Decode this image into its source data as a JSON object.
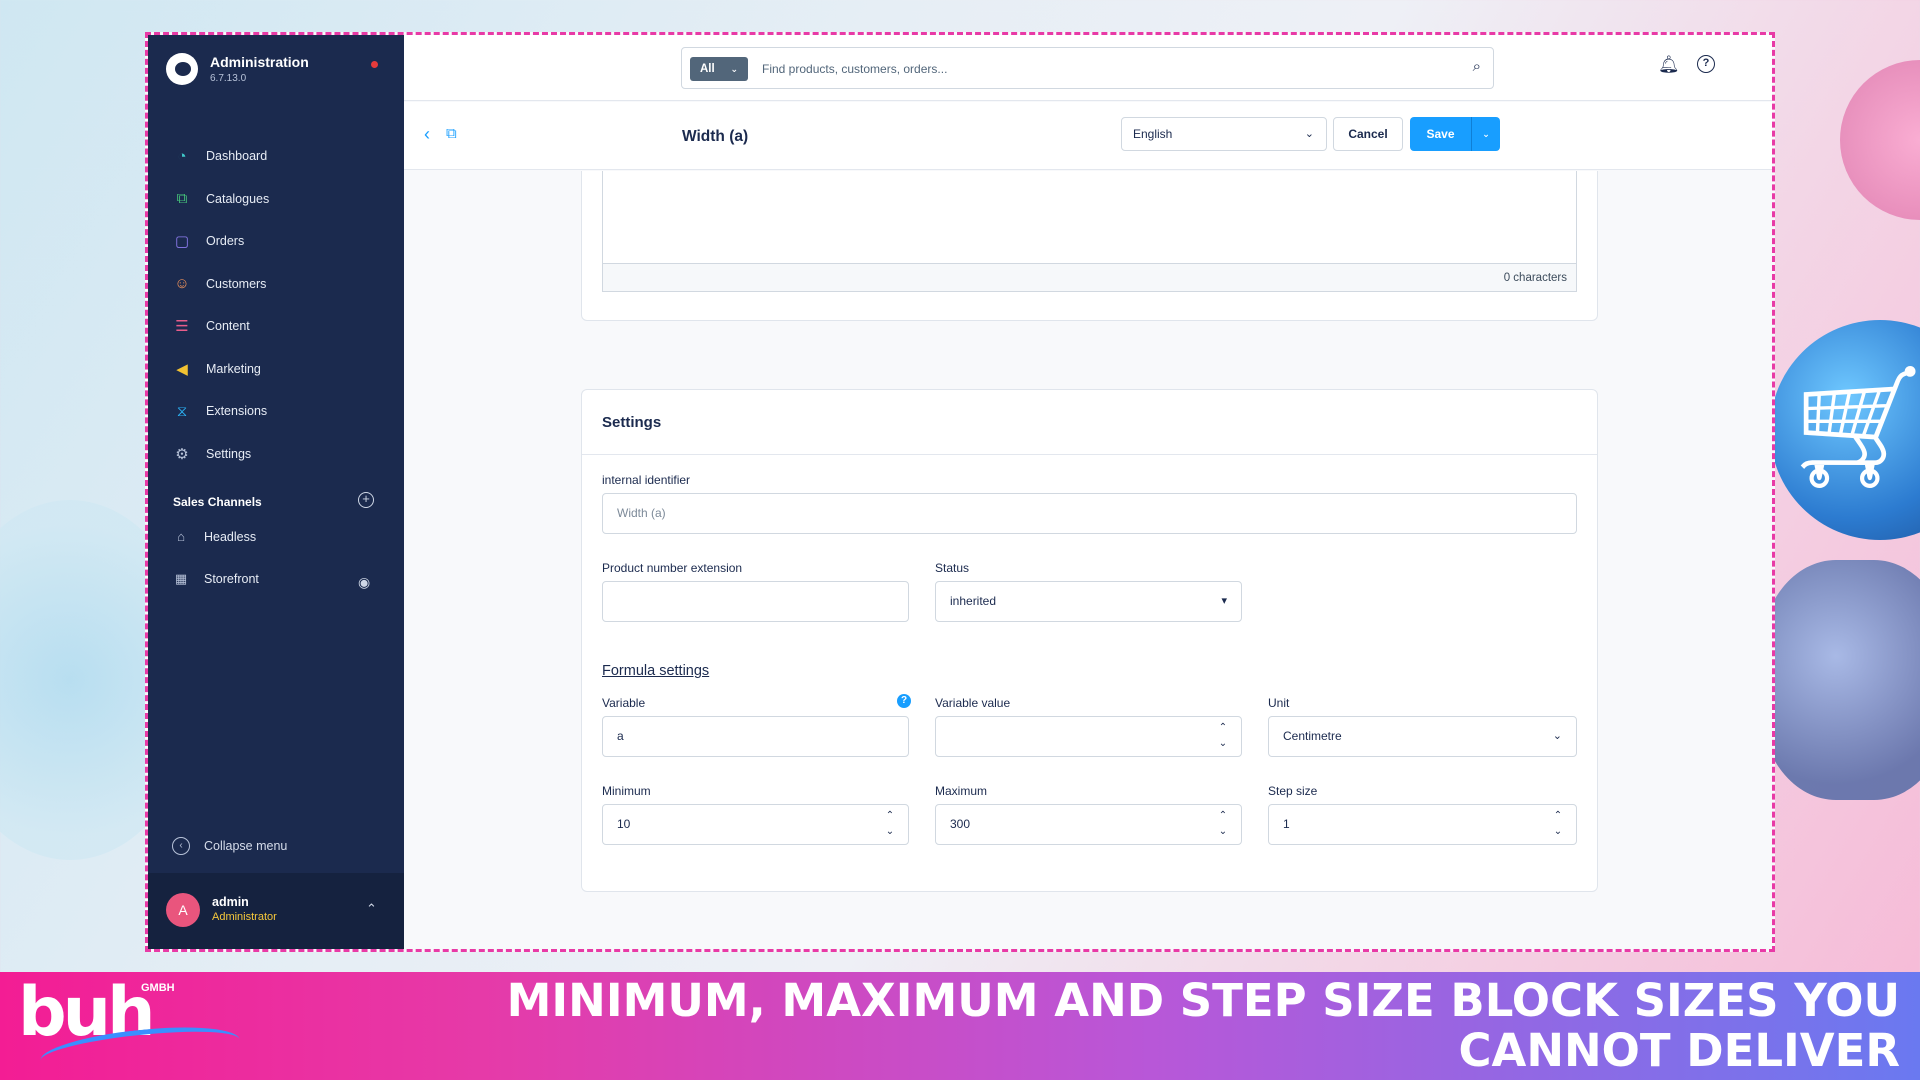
{
  "sidebar": {
    "brand_title": "Administration",
    "brand_version": "6.7.13.0",
    "items": [
      {
        "label": "Dashboard",
        "icon": "dashboard-icon",
        "color": "#3fc7c7"
      },
      {
        "label": "Catalogues",
        "icon": "catalogues-icon",
        "color": "#45c27a"
      },
      {
        "label": "Orders",
        "icon": "orders-icon",
        "color": "#8e7cf0"
      },
      {
        "label": "Customers",
        "icon": "customers-icon",
        "color": "#f0925a"
      },
      {
        "label": "Content",
        "icon": "content-icon",
        "color": "#e95d8b"
      },
      {
        "label": "Marketing",
        "icon": "marketing-icon",
        "color": "#f2c232"
      },
      {
        "label": "Extensions",
        "icon": "extensions-icon",
        "color": "#2bb0f2"
      },
      {
        "label": "Settings",
        "icon": "settings-icon",
        "color": "#b7c2d8"
      }
    ],
    "sales_channels_title": "Sales Channels",
    "channels": [
      {
        "label": "Headless",
        "icon": "basket-icon"
      },
      {
        "label": "Storefront",
        "icon": "storefront-icon"
      }
    ],
    "collapse_label": "Collapse menu",
    "user": {
      "initial": "A",
      "name": "admin",
      "role": "Administrator"
    }
  },
  "topbar": {
    "search_scope": "All",
    "search_placeholder": "Find products, customers, orders..."
  },
  "toolbar": {
    "title": "Width (a)",
    "language": "English",
    "cancel_label": "Cancel",
    "save_label": "Save"
  },
  "description": {
    "char_count": "0 characters"
  },
  "settings": {
    "title": "Settings",
    "internal_identifier_label": "internal identifier",
    "internal_identifier_placeholder": "Width (a)",
    "product_number_label": "Product number extension",
    "product_number_value": "",
    "status_label": "Status",
    "status_value": "inherited",
    "formula_heading": "Formula settings",
    "variable_label": "Variable",
    "variable_value": "a",
    "variable_value_label": "Variable value",
    "variable_value_value": "",
    "unit_label": "Unit",
    "unit_value": "Centimetre",
    "minimum_label": "Minimum",
    "minimum_value": "10",
    "maximum_label": "Maximum",
    "maximum_value": "300",
    "step_label": "Step size",
    "step_value": "1"
  },
  "banner": {
    "logo_text": "buh",
    "logo_suffix": "GMBH",
    "headline": "MINIMUM, MAXIMUM AND STEP SIZE BLOCK SIZES YOU CANNOT DELIVER"
  },
  "colors": {
    "accent": "#189eff",
    "sidebar_bg": "#1b2a4e",
    "frame_border": "#e83aa6"
  }
}
